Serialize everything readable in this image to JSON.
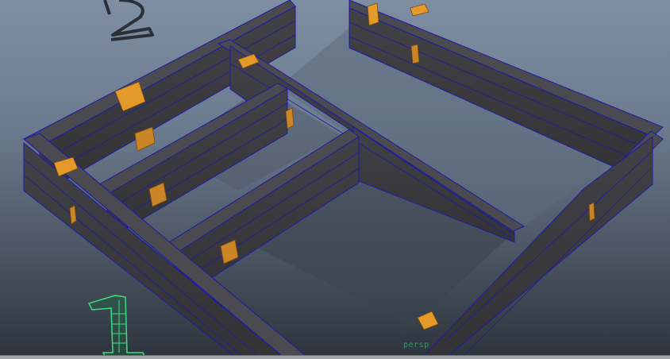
{
  "viewport": {
    "camera_label": "persp",
    "background_top_color": "#7f8ea2",
    "background_bottom_color": "#2d333b"
  },
  "model": {
    "wall_fill_color": "#3a3a3d",
    "wall_top_color": "#4a4a4e",
    "wireframe_color": "#1c1ca8",
    "connector_color": "#e39a2a",
    "markers": [
      {
        "name": "marker-2",
        "text": "2",
        "style": "unselected",
        "color": "#2a2f38"
      },
      {
        "name": "marker-1",
        "text": "1",
        "style": "selected-wireframe",
        "color": "#3ddc84"
      }
    ]
  }
}
